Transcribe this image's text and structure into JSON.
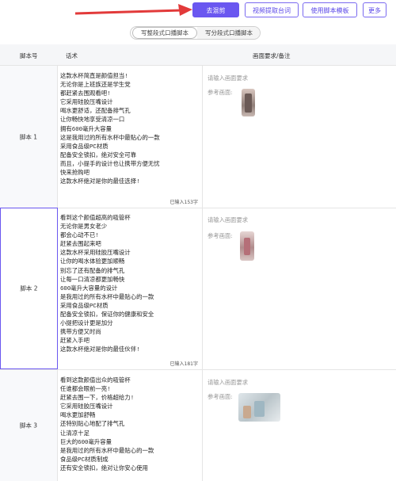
{
  "toolbar": {
    "btn_primary": "去混剪",
    "btn_video": "视频提取台词",
    "btn_template": "使用脚本模板",
    "btn_more": "更多"
  },
  "segment": {
    "active": "写整段式口播脚本",
    "other": "写分段式口播脚本"
  },
  "table": {
    "headers": [
      "脚本号",
      "话术",
      "画面要求/备注"
    ],
    "rows": [
      {
        "id": "脚本 1",
        "script": "这款水杯简直是颜值担当!\n无论你是上班族还是学生党\n都赶紧去围观看吧!\n它采用硅胶压嘴设计\n喝水更舒适，还配备排气孔\n让你畅快地享受清凉一口\n拥有600毫升大容量\n这是我用过的所有水杯中最贴心的一款\n采用食品级PC材质\n配备安全锁扣，绝对安全可靠\n而且，小提手的设计也让携带方便无忧\n快来抢购吧\n这款水杯绝对是你的最佳选择!",
        "count": "已输入153字",
        "req_placeholder": "请输入画面要求",
        "ref_label": "参考画面:"
      },
      {
        "id": "脚本 2",
        "script": "看到这个颜值超高的吸管杯\n无论你是男女老少\n都会心动不已!\n赶紧去围起来吧\n这款水杯采用硅胶压嘴设计\n让你的喝水体验更加顺畅\n别忘了还有配备的排气孔\n让每一口清凉都更加畅快\n600毫升大容量的设计\n是我用过的所有水杯中最贴心的一款\n采用食品级PC材质\n配备安全锁扣，保证你的健康和安全\n小提把设计更是加分\n携带方便又时尚\n赶紧入手吧\n这款水杯绝对是你的最佳伙伴!",
        "count": "已输入181字",
        "req_placeholder": "请输入画面要求",
        "ref_label": "参考画面:"
      },
      {
        "id": "脚本 3",
        "script": "看到这款颜值出众的吸管杯\n任谁都会眼前一亮!\n赶紧去围一下，价格超给力!\n它采用硅胶压嘴设计\n喝水更加舒畅\n还特别贴心地配了排气孔\n让清凉十足\n巨大的600毫升容量\n是我用过的所有水杯中最贴心的一款\n食品级PC材质制成\n还有安全锁扣，绝对让你安心使用",
        "count": "",
        "req_placeholder": "请输入画面要求",
        "ref_label": "参考画面:"
      }
    ]
  },
  "colors": {
    "accent": "#6a57f0",
    "arrow": "#e23a3a"
  }
}
